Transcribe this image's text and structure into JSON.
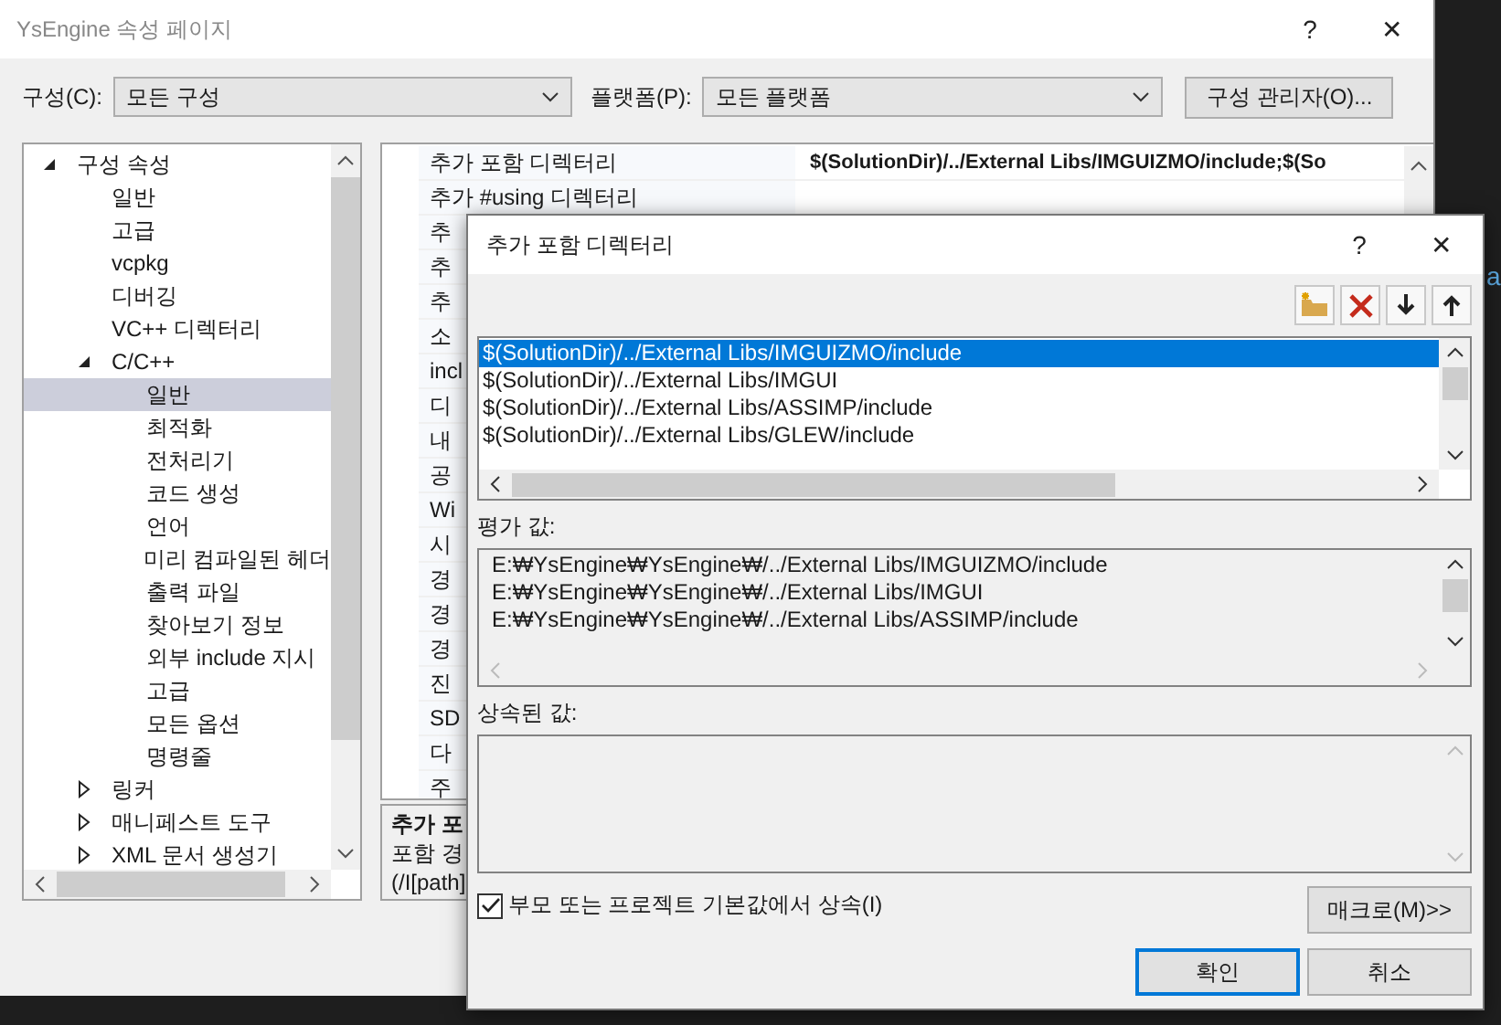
{
  "window": {
    "title": "YsEngine 속성 페이지",
    "help": "?",
    "close": "✕"
  },
  "toolbar": {
    "config_label": "구성(C):",
    "config_value": "모든 구성",
    "platform_label": "플랫폼(P):",
    "platform_value": "모든 플랫폼",
    "manager_button": "구성 관리자(O)..."
  },
  "tree": [
    {
      "label": "구성 속성",
      "expanded": true,
      "selected": false,
      "children": [
        {
          "label": "일반",
          "selected": false
        },
        {
          "label": "고급",
          "selected": false
        },
        {
          "label": "vcpkg",
          "selected": false
        },
        {
          "label": "디버깅",
          "selected": false
        },
        {
          "label": "VC++ 디렉터리",
          "selected": false
        },
        {
          "label": "C/C++",
          "expanded": true,
          "selected": false,
          "children": [
            {
              "label": "일반",
              "selected": true
            },
            {
              "label": "최적화",
              "selected": false
            },
            {
              "label": "전처리기",
              "selected": false
            },
            {
              "label": "코드 생성",
              "selected": false
            },
            {
              "label": "언어",
              "selected": false
            },
            {
              "label": "미리 컴파일된 헤더",
              "selected": false
            },
            {
              "label": "출력 파일",
              "selected": false
            },
            {
              "label": "찾아보기 정보",
              "selected": false
            },
            {
              "label": "외부 include 지시",
              "selected": false
            },
            {
              "label": "고급",
              "selected": false
            },
            {
              "label": "모든 옵션",
              "selected": false
            },
            {
              "label": "명령줄",
              "selected": false
            }
          ]
        },
        {
          "label": "링커",
          "expanded": false,
          "selected": false
        },
        {
          "label": "매니페스트 도구",
          "expanded": false,
          "selected": false
        },
        {
          "label": "XML 문서 생성기",
          "expanded": false,
          "selected": false
        }
      ]
    }
  ],
  "grid": {
    "rows": [
      {
        "label": "추가 포함 디렉터리",
        "value": "$(SolutionDir)/../External Libs/IMGUIZMO/include;$(So"
      },
      {
        "label": "추가 #using 디렉터리"
      },
      {
        "label": "추"
      },
      {
        "label": "추"
      },
      {
        "label": "추"
      },
      {
        "label": "소"
      },
      {
        "label": "incl"
      },
      {
        "label": "디"
      },
      {
        "label": "내"
      },
      {
        "label": "공"
      },
      {
        "label": "Wi"
      },
      {
        "label": "시"
      },
      {
        "label": "경"
      },
      {
        "label": "경"
      },
      {
        "label": "경"
      },
      {
        "label": "진"
      },
      {
        "label": "SD"
      },
      {
        "label": "다"
      },
      {
        "label": "주"
      }
    ],
    "description": {
      "title": "추가 포",
      "lines": [
        "포함 경",
        "(/I[path]"
      ]
    }
  },
  "editor_fragment": "a",
  "dialog": {
    "title": "추가 포함 디렉터리",
    "help": "?",
    "close": "✕",
    "tools": [
      {
        "kind": "new-folder"
      },
      {
        "kind": "delete"
      },
      {
        "kind": "down"
      },
      {
        "kind": "up"
      }
    ],
    "list": [
      {
        "text": "$(SolutionDir)/../External Libs/IMGUIZMO/include",
        "selected": true
      },
      {
        "text": "$(SolutionDir)/../External Libs/IMGUI",
        "selected": false
      },
      {
        "text": "$(SolutionDir)/../External Libs/ASSIMP/include",
        "selected": false
      },
      {
        "text": "$(SolutionDir)/../External Libs/GLEW/include",
        "selected": false
      }
    ],
    "evaluated_label": "평가 값:",
    "evaluated": [
      "E:₩YsEngine₩YsEngine₩/../External Libs/IMGUIZMO/include",
      "E:₩YsEngine₩YsEngine₩/../External Libs/IMGUI",
      "E:₩YsEngine₩YsEngine₩/../External Libs/ASSIMP/include"
    ],
    "inherited_label": "상속된 값:",
    "inherit": {
      "label": "부모 또는 프로젝트 기본값에서 상속(I)",
      "checked": true
    },
    "macro_button": "매크로(M)>>",
    "ok_button": "확인",
    "cancel_button": "취소"
  }
}
